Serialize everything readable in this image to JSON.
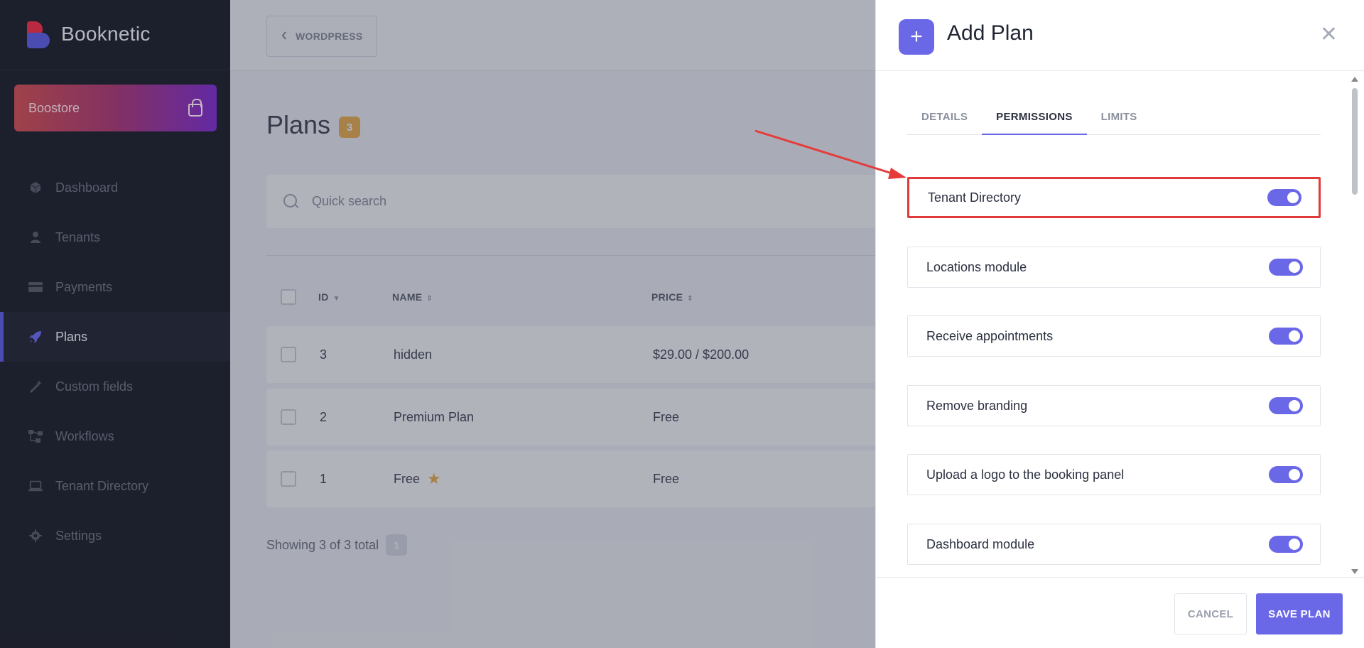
{
  "sidebar": {
    "brand": "Booknetic",
    "boostore_label": "Boostore",
    "items": [
      {
        "label": "Dashboard",
        "icon": "cube-icon"
      },
      {
        "label": "Tenants",
        "icon": "user-icon"
      },
      {
        "label": "Payments",
        "icon": "credit-card-icon"
      },
      {
        "label": "Plans",
        "icon": "rocket-icon",
        "active": true
      },
      {
        "label": "Custom fields",
        "icon": "wand-icon"
      },
      {
        "label": "Workflows",
        "icon": "workflow-icon"
      },
      {
        "label": "Tenant Directory",
        "icon": "laptop-icon"
      },
      {
        "label": "Settings",
        "icon": "gear-icon"
      }
    ]
  },
  "topbar": {
    "wordpress_label": "WORDPRESS"
  },
  "page": {
    "title": "Plans",
    "count": "3",
    "search_placeholder": "Quick search",
    "columns": [
      "ID",
      "NAME",
      "PRICE"
    ],
    "rows": [
      {
        "id": "3",
        "name": "hidden",
        "price": "$29.00 / $200.00"
      },
      {
        "id": "2",
        "name": "Premium Plan",
        "price": "Free"
      },
      {
        "id": "1",
        "name": "Free",
        "price": "Free",
        "starred": true
      }
    ],
    "showing_text": "Showing 3 of 3 total",
    "page_number": "1"
  },
  "drawer": {
    "title": "Add Plan",
    "tabs": [
      "DETAILS",
      "PERMISSIONS",
      "LIMITS"
    ],
    "active_tab": "PERMISSIONS",
    "permissions": [
      {
        "label": "Tenant Directory",
        "enabled": true
      },
      {
        "label": "Locations module",
        "enabled": true
      },
      {
        "label": "Receive appointments",
        "enabled": true
      },
      {
        "label": "Remove branding",
        "enabled": true
      },
      {
        "label": "Upload a logo to the booking panel",
        "enabled": true
      },
      {
        "label": "Dashboard module",
        "enabled": true
      }
    ],
    "cancel_label": "CANCEL",
    "save_label": "SAVE PLAN"
  },
  "colors": {
    "accent": "#6b68e8",
    "sidebar_bg": "#1f2230",
    "highlight": "#e03a3a",
    "badge": "#f0a93a"
  }
}
